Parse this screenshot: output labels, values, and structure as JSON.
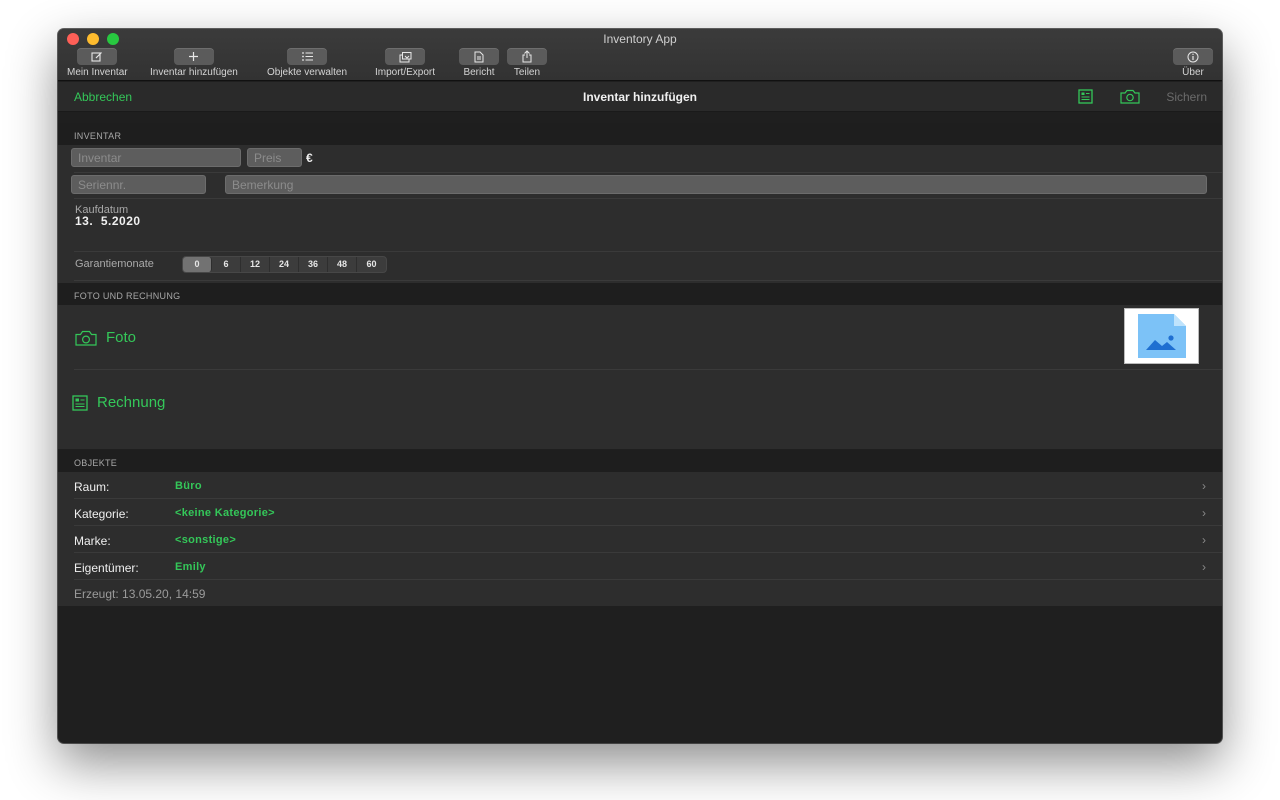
{
  "window": {
    "title": "Inventory App"
  },
  "toolbar": {
    "items": [
      {
        "label": "Mein Inventar",
        "icon": "compose-icon"
      },
      {
        "label": "Inventar hinzufügen",
        "icon": "plus-icon"
      },
      {
        "label": "Objekte verwalten",
        "icon": "list-icon"
      },
      {
        "label": "Import/Export",
        "icon": "import-export-icon"
      },
      {
        "label": "Bericht",
        "icon": "document-icon"
      },
      {
        "label": "Teilen",
        "icon": "share-icon"
      },
      {
        "label": "Über",
        "icon": "info-icon"
      }
    ]
  },
  "nav": {
    "cancel": "Abbrechen",
    "title": "Inventar hinzufügen",
    "save": "Sichern"
  },
  "sections": {
    "inventar": "INVENTAR",
    "foto": "FOTO UND RECHNUNG",
    "objekte": "OBJEKTE"
  },
  "form": {
    "inventar_placeholder": "Inventar",
    "preis_placeholder": "Preis",
    "currency": "€",
    "serial_placeholder": "Seriennr.",
    "note_placeholder": "Bemerkung",
    "kaufdatum_label": "Kaufdatum",
    "kaufdatum_value": "13.  5.2020",
    "garantie_label": "Garantiemonate",
    "garantie_options": [
      "0",
      "6",
      "12",
      "24",
      "36",
      "48",
      "60"
    ],
    "garantie_selected": "0"
  },
  "media": {
    "foto": "Foto",
    "rechnung": "Rechnung"
  },
  "objekte": [
    {
      "key": "Raum:",
      "value": "Büro"
    },
    {
      "key": "Kategorie:",
      "value": "<keine Kategorie>"
    },
    {
      "key": "Marke:",
      "value": "<sonstige>"
    },
    {
      "key": "Eigentümer:",
      "value": "Emily"
    }
  ],
  "created": "Erzeugt: 13.05.20, 14:59",
  "colors": {
    "accent": "#34c759",
    "background": "#1f1f1f",
    "row": "#2d2d2d"
  }
}
